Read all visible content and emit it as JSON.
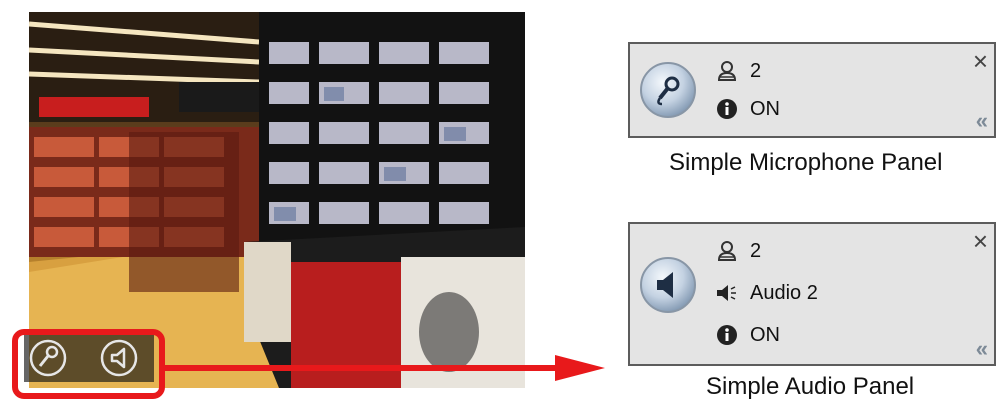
{
  "microphone_panel": {
    "user_count": "2",
    "status": "ON",
    "caption": "Simple Microphone Panel"
  },
  "audio_panel": {
    "user_count": "2",
    "audio_source": "Audio 2",
    "status": "ON",
    "caption": "Simple Audio Panel"
  },
  "icons": {
    "close": "×",
    "collapse": "«"
  },
  "colors": {
    "highlight": "#e8191b",
    "panel_bg": "#e4e4e4"
  }
}
